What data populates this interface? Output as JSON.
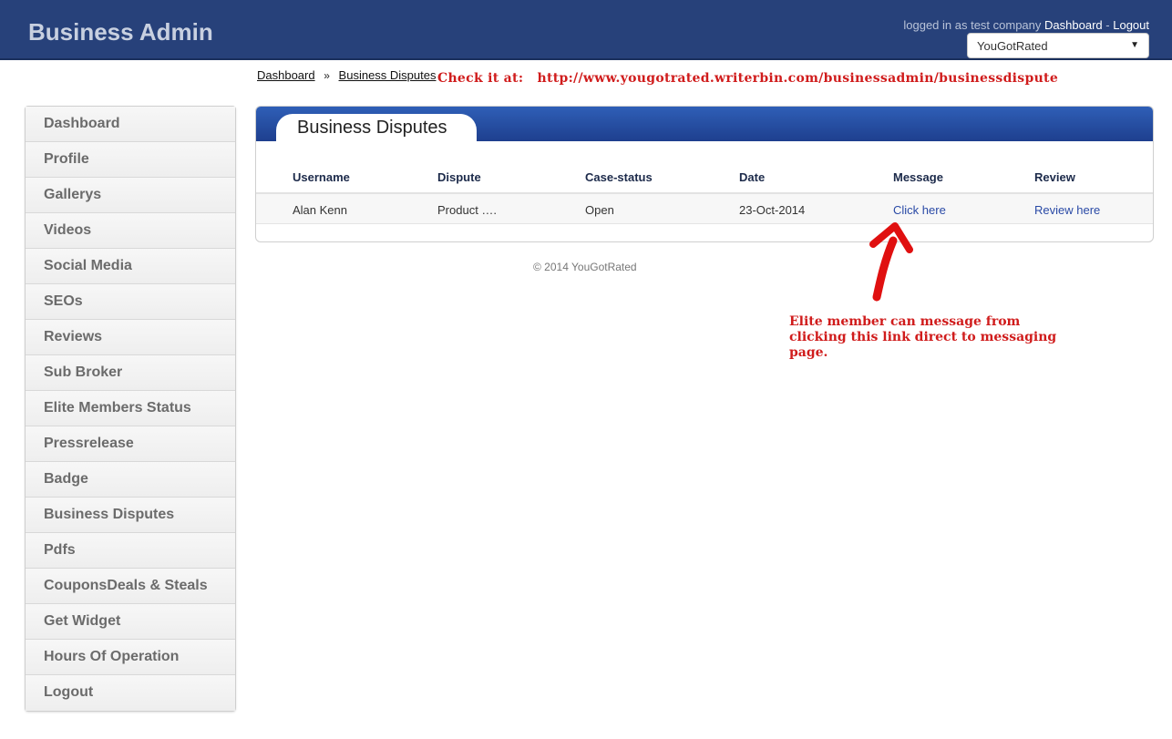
{
  "header": {
    "brand": "Business Admin",
    "logged_in_prefix": "logged in as test company",
    "dashboard_link": "Dashboard",
    "separator": "-",
    "logout_link": "Logout",
    "company_select": "YouGotRated"
  },
  "breadcrumb": {
    "items": [
      "Dashboard",
      "Business Disputes"
    ],
    "separator": "»"
  },
  "annotation": {
    "check_label": "Check it at:",
    "check_url": "http://www.yougotrated.writerbin.com/businessadmin/businessdispute",
    "note": "Elite member can message from clicking this link direct to messaging page."
  },
  "sidebar": {
    "items": [
      {
        "label": "Dashboard"
      },
      {
        "label": "Profile"
      },
      {
        "label": "Gallerys"
      },
      {
        "label": "Videos"
      },
      {
        "label": "Social Media"
      },
      {
        "label": "SEOs"
      },
      {
        "label": "Reviews"
      },
      {
        "label": "Sub Broker"
      },
      {
        "label": "Elite Members Status"
      },
      {
        "label": "Pressrelease"
      },
      {
        "label": "Badge"
      },
      {
        "label": "Business Disputes"
      },
      {
        "label": "Pdfs"
      },
      {
        "label": "CouponsDeals & Steals"
      },
      {
        "label": "Get Widget"
      },
      {
        "label": "Hours Of Operation"
      },
      {
        "label": "Logout"
      }
    ]
  },
  "panel": {
    "title": "Business Disputes",
    "columns": [
      "Username",
      "Dispute",
      "Case-status",
      "Date",
      "Message",
      "Review"
    ],
    "rows": [
      {
        "username": "Alan Kenn",
        "dispute": "Product ….",
        "status": "Open",
        "date": "23-Oct-2014",
        "message": "Click here",
        "review": "Review here"
      }
    ]
  },
  "footer": {
    "copyright": "© 2014 YouGotRated"
  },
  "colors": {
    "header_bg": "#27417a",
    "panel_head": "#2f5fb7",
    "annotation_red": "#d01c1c",
    "link_blue": "#2a4aa6"
  }
}
